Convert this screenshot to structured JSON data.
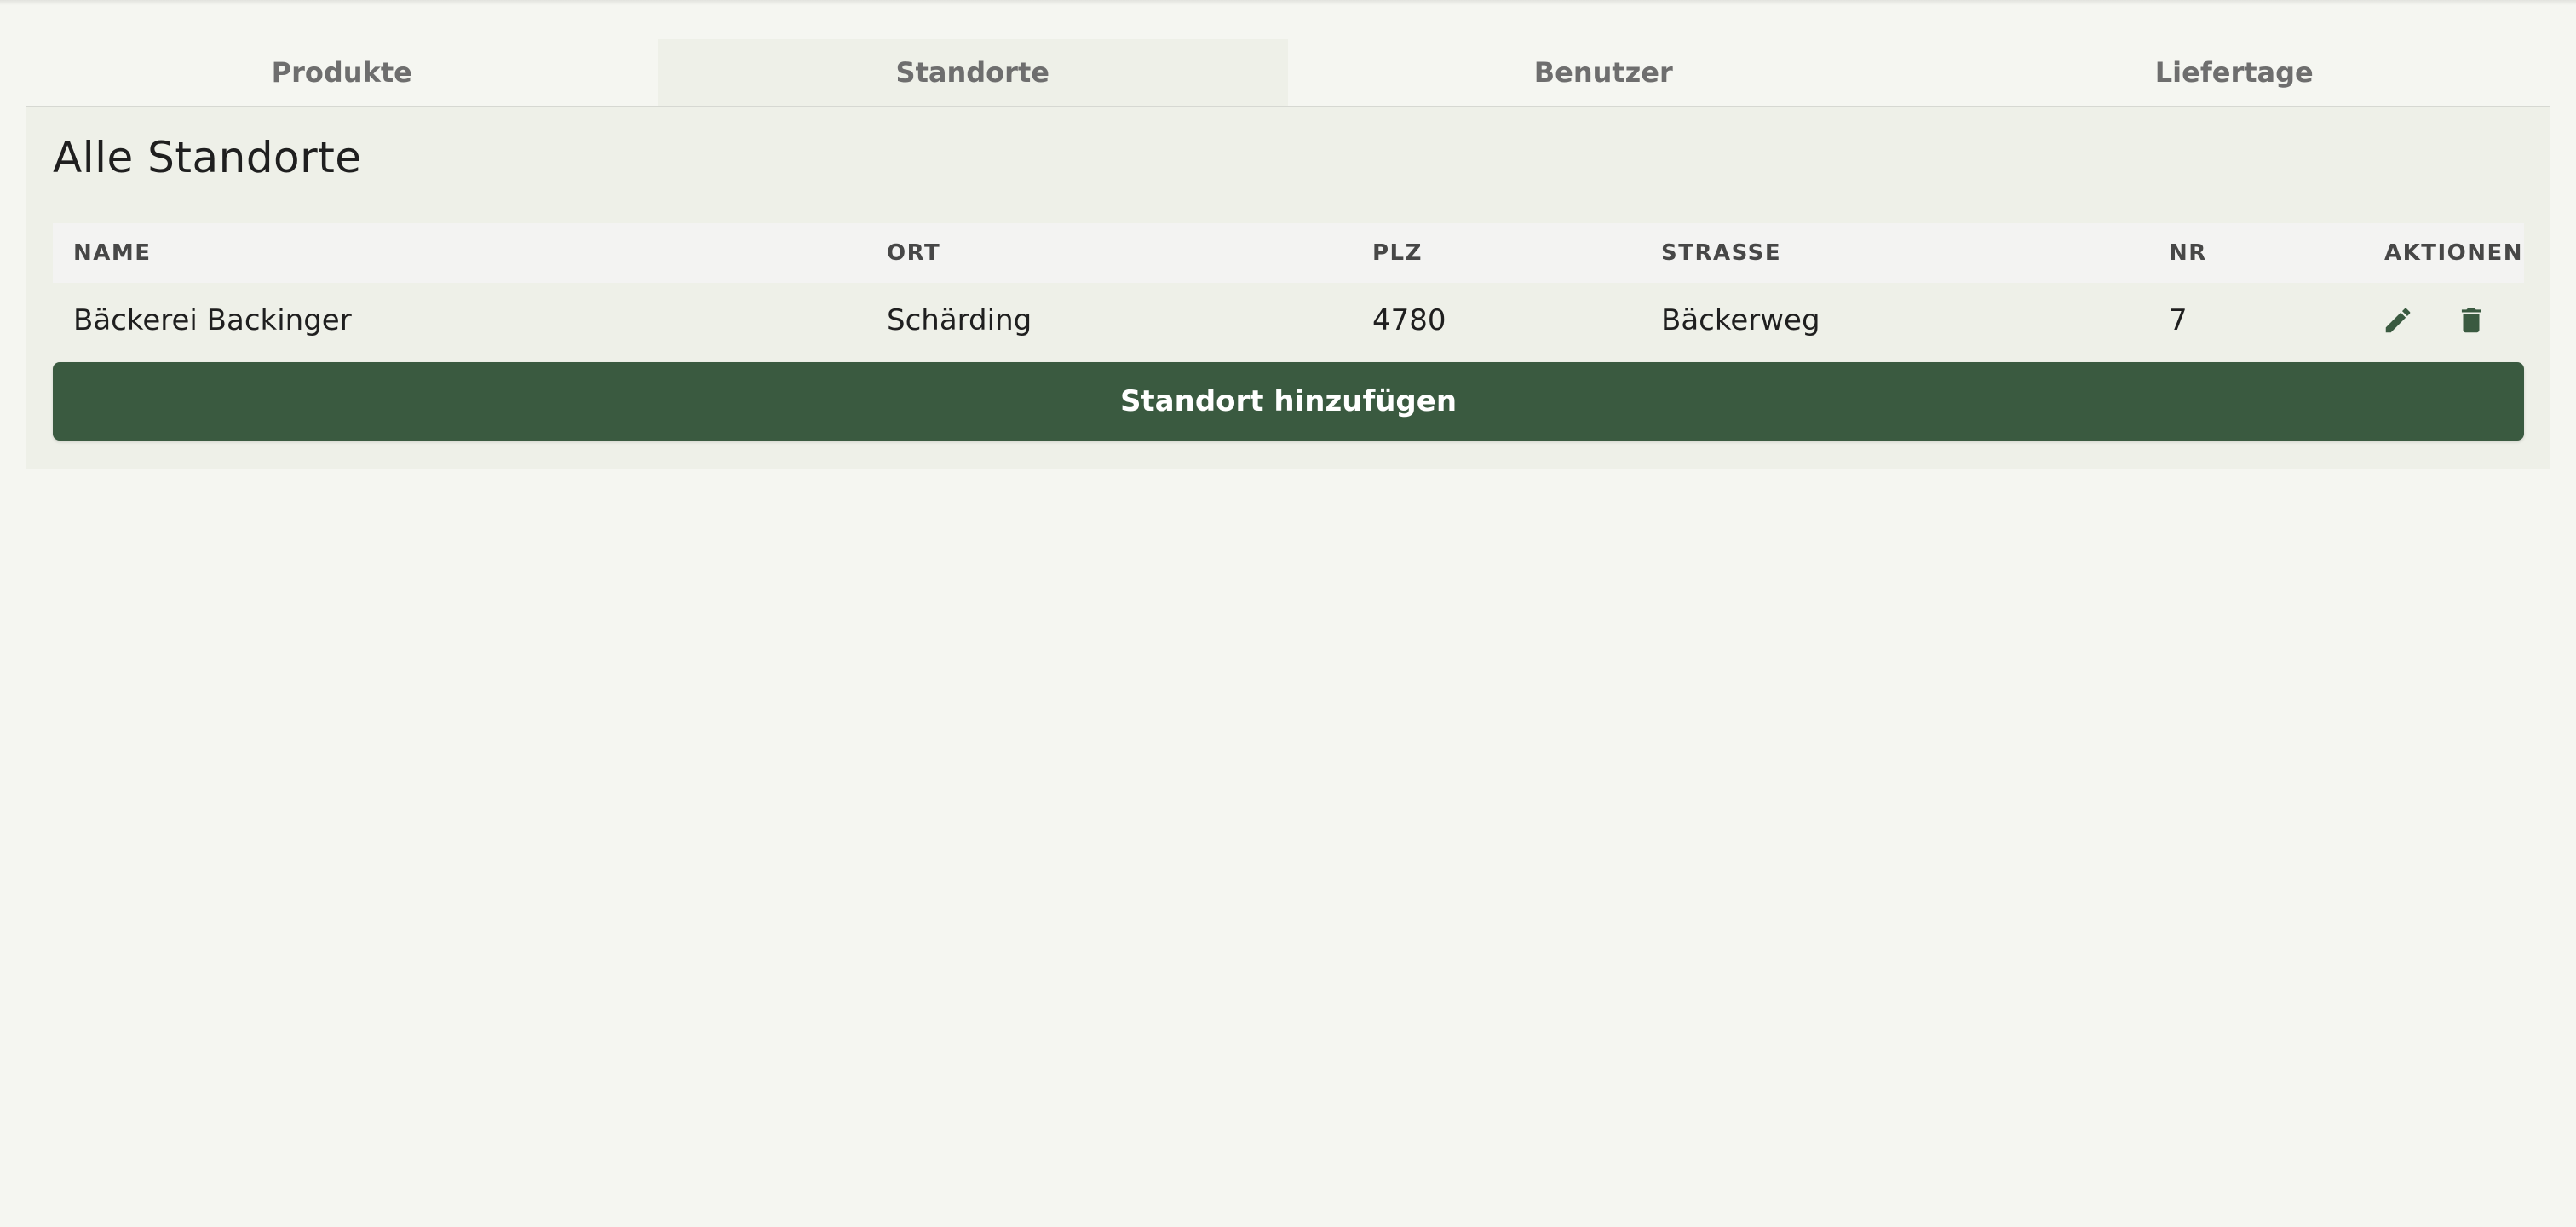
{
  "tabs": [
    {
      "label": "Produkte",
      "active": false
    },
    {
      "label": "Standorte",
      "active": true
    },
    {
      "label": "Benutzer",
      "active": false
    },
    {
      "label": "Liefertage",
      "active": false
    }
  ],
  "page_title": "Alle Standorte",
  "table": {
    "columns": [
      "NAME",
      "ORT",
      "PLZ",
      "STRASSE",
      "NR",
      "AKTIONEN"
    ],
    "rows": [
      {
        "name": "Bäckerei Backinger",
        "ort": "Schärding",
        "plz": "4780",
        "strasse": "Bäckerweg",
        "nr": "7",
        "actions": [
          "pencil-icon",
          "trash-icon"
        ]
      }
    ]
  },
  "add_button_label": "Standort hinzufügen",
  "colors": {
    "accent": "#3a5a40",
    "background": "#f5f6f1",
    "card": "#eef0e8",
    "table_header": "#f3f3f2"
  }
}
